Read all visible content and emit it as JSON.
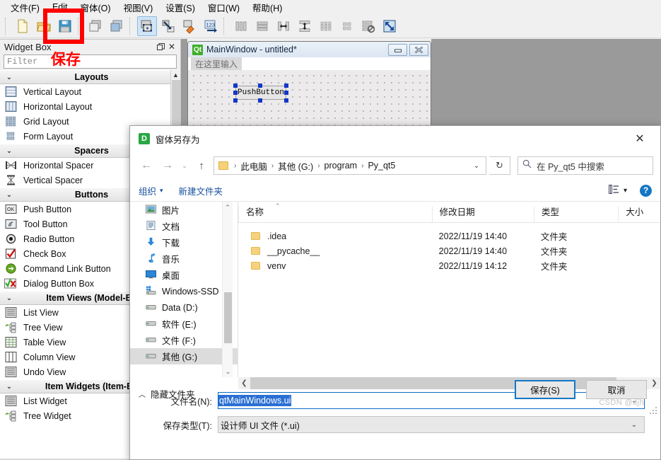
{
  "app": {
    "menubar": [
      {
        "label": "文件(F)"
      },
      {
        "label": "Edit"
      },
      {
        "label": "窗体(O)"
      },
      {
        "label": "视图(V)"
      },
      {
        "label": "设置(S)"
      },
      {
        "label": "窗口(W)"
      },
      {
        "label": "帮助(H)"
      }
    ],
    "toolbar": [
      {
        "name": "new-form",
        "title": "新建"
      },
      {
        "name": "open-form",
        "title": "打开"
      },
      {
        "name": "save-form",
        "title": "保存"
      },
      {
        "name": "undo",
        "title": "撤销"
      },
      {
        "name": "redo",
        "title": "重做"
      },
      {
        "name": "edit-widgets",
        "title": "编辑控件"
      },
      {
        "name": "edit-signals-slots",
        "title": "编辑信号/槽"
      },
      {
        "name": "edit-buddies",
        "title": "编辑伙伴"
      },
      {
        "name": "edit-tab-order",
        "title": "编辑 Tab 顺序"
      },
      {
        "name": "layout-horizontally",
        "title": "水平布局"
      },
      {
        "name": "layout-vertically",
        "title": "垂直布局"
      },
      {
        "name": "layout-splitter-h",
        "title": "水平分裂器布局"
      },
      {
        "name": "layout-splitter-v",
        "title": "垂直分裂器布局"
      },
      {
        "name": "layout-grid",
        "title": "栅格布局"
      },
      {
        "name": "layout-form",
        "title": "表单布局"
      },
      {
        "name": "break-layout",
        "title": "打破布局"
      },
      {
        "name": "adjust-size",
        "title": "调整大小"
      }
    ]
  },
  "annotation": {
    "label": "保存"
  },
  "widget_box": {
    "title": "Widget Box",
    "filter_placeholder": "Filter",
    "groups": [
      {
        "label": "Layouts",
        "items": [
          {
            "label": "Vertical Layout",
            "icon": "vertical-layout-icon"
          },
          {
            "label": "Horizontal Layout",
            "icon": "horizontal-layout-icon"
          },
          {
            "label": "Grid Layout",
            "icon": "grid-layout-icon"
          },
          {
            "label": "Form Layout",
            "icon": "form-layout-icon"
          }
        ]
      },
      {
        "label": "Spacers",
        "items": [
          {
            "label": "Horizontal Spacer",
            "icon": "horizontal-spacer-icon"
          },
          {
            "label": "Vertical Spacer",
            "icon": "vertical-spacer-icon"
          }
        ]
      },
      {
        "label": "Buttons",
        "items": [
          {
            "label": "Push Button",
            "icon": "push-button-icon"
          },
          {
            "label": "Tool Button",
            "icon": "tool-button-icon"
          },
          {
            "label": "Radio Button",
            "icon": "radio-button-icon"
          },
          {
            "label": "Check Box",
            "icon": "check-box-icon"
          },
          {
            "label": "Command Link Button",
            "icon": "command-link-button-icon"
          },
          {
            "label": "Dialog Button Box",
            "icon": "dialog-button-box-icon"
          }
        ]
      },
      {
        "label": "Item Views (Model-Ba",
        "items": [
          {
            "label": "List View",
            "icon": "list-view-icon"
          },
          {
            "label": "Tree View",
            "icon": "tree-view-icon"
          },
          {
            "label": "Table View",
            "icon": "table-view-icon"
          },
          {
            "label": "Column View",
            "icon": "column-view-icon"
          },
          {
            "label": "Undo View",
            "icon": "undo-view-icon"
          }
        ]
      },
      {
        "label": "Item Widgets (Item-Ba",
        "items": [
          {
            "label": "List Widget",
            "icon": "list-widget-icon"
          },
          {
            "label": "Tree Widget",
            "icon": "tree-widget-icon"
          }
        ]
      }
    ]
  },
  "main_window": {
    "title": "MainWindow - untitled*",
    "qt_badge": "Qt",
    "menu_hint": "在这里输入",
    "minimize_label": "—",
    "close_label": "✕",
    "push_button_label": "PushButton"
  },
  "dialog": {
    "title": "窗体另存为",
    "icon_letter": "D",
    "close_label": "✕",
    "nav": {
      "back": "←",
      "forward": "→",
      "history": "⌄",
      "up": "↑",
      "breadcrumbs": [
        "此电脑",
        "其他 (G:)",
        "program",
        "Py_qt5"
      ],
      "separator": "›",
      "dropdown": "⌄",
      "refresh": "↻",
      "search_placeholder": "在 Py_qt5 中搜索"
    },
    "tools": {
      "organize": "组织",
      "organize_caret": "▾",
      "new_folder": "新建文件夹",
      "view_caret": "▾"
    },
    "tree": {
      "items": [
        {
          "label": "图片",
          "icon": "pictures-icon",
          "selected": false
        },
        {
          "label": "文档",
          "icon": "documents-icon",
          "selected": false
        },
        {
          "label": "下载",
          "icon": "downloads-icon",
          "selected": false
        },
        {
          "label": "音乐",
          "icon": "music-icon",
          "selected": false
        },
        {
          "label": "桌面",
          "icon": "desktop-icon",
          "selected": false
        },
        {
          "label": "Windows-SSD",
          "icon": "windows-drive-icon",
          "selected": false
        },
        {
          "label": "Data (D:)",
          "icon": "drive-icon",
          "selected": false
        },
        {
          "label": "软件 (E:)",
          "icon": "drive-icon",
          "selected": false
        },
        {
          "label": "文件 (F:)",
          "icon": "drive-icon",
          "selected": false
        },
        {
          "label": "其他 (G:)",
          "icon": "drive-icon",
          "selected": true
        }
      ]
    },
    "file_list": {
      "columns": [
        "名称",
        "修改日期",
        "类型",
        "大小"
      ],
      "rows": [
        {
          "name": ".idea",
          "modified": "2022/11/19 14:40",
          "type": "文件夹",
          "size": ""
        },
        {
          "name": "__pycache__",
          "modified": "2022/11/19 14:40",
          "type": "文件夹",
          "size": ""
        },
        {
          "name": "venv",
          "modified": "2022/11/19 14:12",
          "type": "文件夹",
          "size": ""
        }
      ]
    },
    "fields": {
      "filename_label": "文件名(N):",
      "filename_value": "qtMainWindows.ui",
      "filetype_label": "保存类型(T):",
      "filetype_value": "设计师 UI 文件 (*.ui)",
      "dropdown_caret": "⌄"
    },
    "footer": {
      "hide_folders": "隐藏文件夹",
      "hide_folders_caret": "︿",
      "save_button": "保存(S)",
      "cancel_button": "取消"
    }
  },
  "watermark": "CSDN @djh"
}
